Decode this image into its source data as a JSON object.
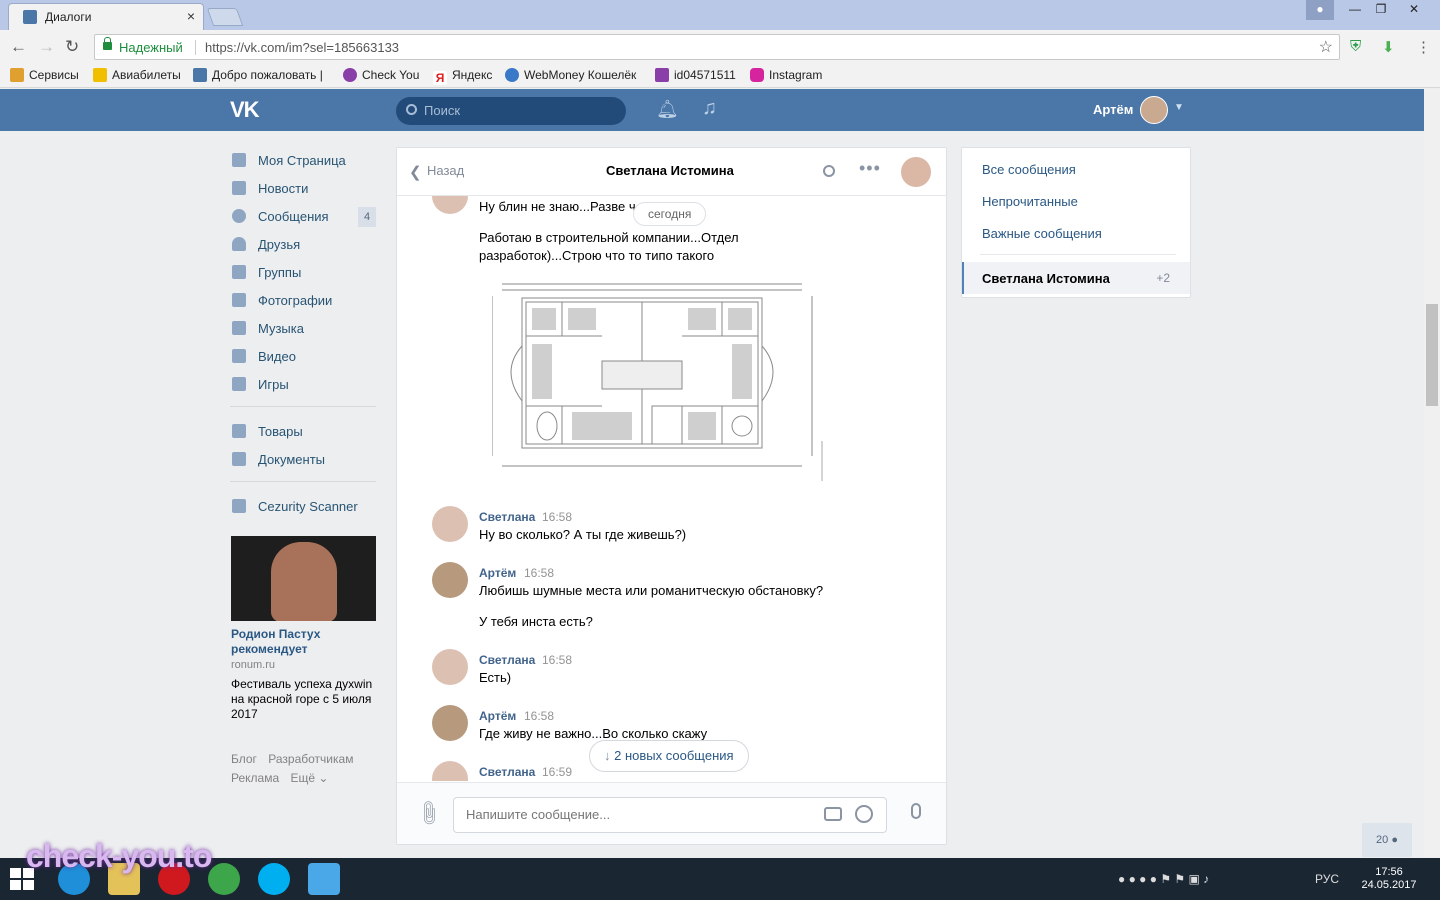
{
  "browser": {
    "tab_title": "Диалоги",
    "tab_close": "×",
    "secure_label": "Надежный",
    "url": "https://vk.com/im?sel=185663133"
  },
  "bookmarks": [
    "Сервисы",
    "Авиабилеты",
    "Добро пожаловать |",
    "Check You",
    "Яндекс",
    "WebMoney Кошелёк",
    "id04571511",
    "Instagram"
  ],
  "vk_header": {
    "logo": "VK",
    "search_placeholder": "Поиск",
    "user_name": "Артём"
  },
  "left_menu": {
    "items": [
      {
        "label": "Моя Страница"
      },
      {
        "label": "Новости"
      },
      {
        "label": "Сообщения",
        "badge": "4"
      },
      {
        "label": "Друзья"
      },
      {
        "label": "Группы"
      },
      {
        "label": "Фотографии"
      },
      {
        "label": "Музыка"
      },
      {
        "label": "Видео"
      },
      {
        "label": "Игры"
      }
    ],
    "items2": [
      {
        "label": "Товары"
      },
      {
        "label": "Документы"
      }
    ],
    "apps": [
      {
        "label": "Cezurity Scanner"
      }
    ]
  },
  "ad": {
    "title": "Родион Пастух рекомендует",
    "domain": "ronum.ru",
    "text": "Фестиваль успеха духwin на красной горе с 5 июля 2017"
  },
  "footer_links": [
    "Блог",
    "Разработчикам",
    "Реклама",
    "Ещё ⌄"
  ],
  "chat": {
    "back_label": "Назад",
    "title": "Светлана Истомина",
    "date_pill": "сегодня",
    "messages": [
      {
        "text": "Ну блин не знаю...Разве ч"
      },
      {
        "text": "Работаю в строительной компании...Отдел разработок)...Строю что то типо такого"
      },
      {
        "author": "Светлана",
        "time": "16:58",
        "text": "Ну во сколько? А ты где живешь?)"
      },
      {
        "author": "Артём",
        "time": "16:58",
        "text": "Любишь шумные места или романитческую обстановку?",
        "text2": "У тебя инста есть?"
      },
      {
        "author": "Светлана",
        "time": "16:58",
        "text": "Есть)"
      },
      {
        "author": "Артём",
        "time": "16:58",
        "text": "Где живу не важно...Во сколько скажу"
      },
      {
        "author": "Светлана",
        "time": "16:59",
        "text": ""
      }
    ],
    "new_messages": "2 новых сообщения",
    "input_placeholder": "Напишите сообщение..."
  },
  "right_panel": {
    "items": [
      "Все сообщения",
      "Непрочитанные",
      "Важные сообщения"
    ],
    "active_label": "Светлана Истомина",
    "active_count": "+2"
  },
  "online_count": "20",
  "taskbar": {
    "lang": "РУС",
    "time": "17:56",
    "date": "24.05.2017"
  },
  "watermark": "check-you.to",
  "colors": {
    "vk_blue": "#4a76a8",
    "link": "#2a5885",
    "taskbar": "#1b2633"
  }
}
